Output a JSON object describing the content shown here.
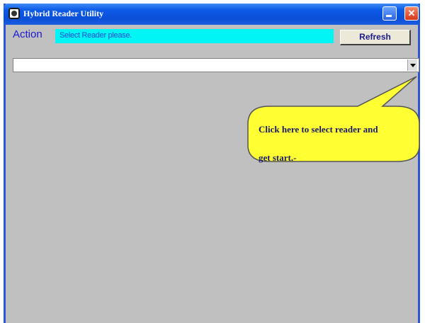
{
  "window": {
    "title": "Hybrid Reader Utility"
  },
  "toolbar": {
    "action_label": "Action",
    "status_text": "Select Reader please.",
    "refresh_label": "Refresh"
  },
  "reader_select": {
    "value": ""
  },
  "callout": {
    "line1": "Click here to select reader and",
    "line2": "get start.-"
  },
  "colors": {
    "titlebar": "#0a4fd6",
    "status_bg": "#00f5f5",
    "action_text": "#1a1ad0",
    "callout_fill": "#ffff33",
    "client_bg": "#c0c0c0"
  },
  "icons": {
    "app": "app-icon",
    "minimize": "minimize-icon",
    "maximize": "maximize-icon",
    "close": "close-icon",
    "dropdown": "chevron-down-icon"
  }
}
